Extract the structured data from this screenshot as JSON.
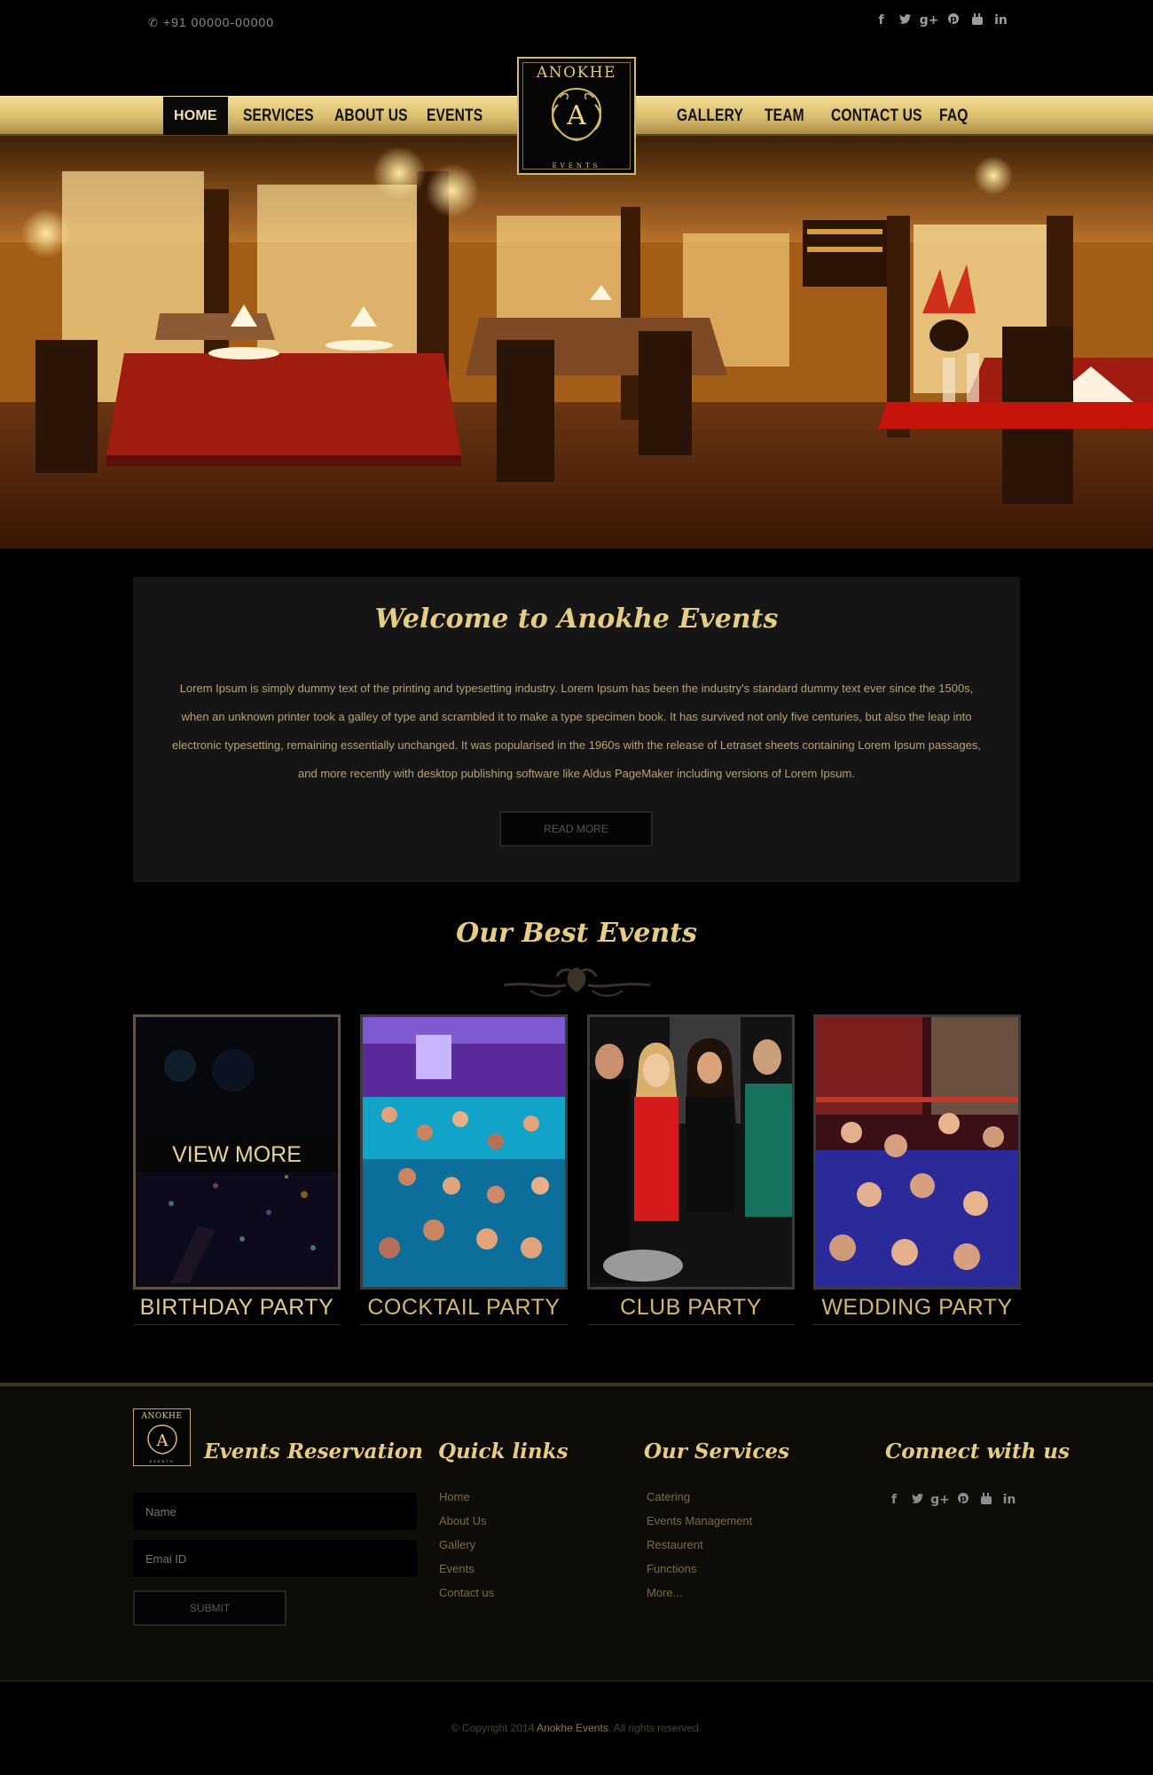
{
  "topbar": {
    "phone": "+91 00000-00000",
    "phone_icon": "phone-icon",
    "social": [
      "f",
      "🐦",
      "g+",
      "p",
      "▶",
      "in"
    ]
  },
  "nav": {
    "items": [
      "HOME",
      "SERVICES",
      "ABOUT US",
      "EVENTS",
      "GALLERY",
      "TEAM",
      "CONTACT US",
      "FAQ"
    ],
    "active": "HOME"
  },
  "logo": {
    "title": "ANOKHE",
    "letter": "A",
    "subtitle": "EVENTS"
  },
  "welcome": {
    "title": "Welcome to Anokhe Events",
    "body": "Lorem Ipsum is simply dummy text of the printing and typesetting industry. Lorem Ipsum has been the industry's standard dummy text ever since the 1500s, when an unknown printer took a galley of type and scrambled it to make a type specimen book. It has survived not only five centuries, but also the leap into electronic typesetting, remaining essentially unchanged. It was popularised in the 1960s with the release of Letraset sheets containing Lorem Ipsum passages, and more recently with desktop publishing software like Aldus PageMaker including versions of Lorem Ipsum.",
    "button": "READ MORE"
  },
  "events": {
    "title": "Our Best Events",
    "view_more": "VIEW MORE",
    "items": [
      {
        "label": "BIRTHDAY PARTY"
      },
      {
        "label": "COCKTAIL PARTY"
      },
      {
        "label": "CLUB PARTY"
      },
      {
        "label": "WEDDING PARTY"
      }
    ]
  },
  "footer": {
    "logo": {
      "title": "ANOKHE",
      "letter": "A",
      "subtitle": "EVENTS"
    },
    "reservation": {
      "title": "Events Reservation",
      "name_placeholder": "Name",
      "email_placeholder": "Emai ID",
      "submit": "SUBMIT"
    },
    "quick_links": {
      "title": "Quick links",
      "items": [
        "Home",
        "About Us",
        "Gallery",
        "Events",
        "Contact us"
      ]
    },
    "services": {
      "title": "Our Services",
      "items": [
        "Catering",
        "Events Management",
        "Restaurent",
        "Functions",
        "More..."
      ]
    },
    "connect": {
      "title": "Connect with us",
      "social": [
        "f",
        "🐦",
        "g+",
        "p",
        "▶",
        "in"
      ]
    }
  },
  "copyright": {
    "prefix": "© Copyright 2014",
    "brand": "Anokhe Events",
    "suffix": ". All rights reserved."
  },
  "colors": {
    "gold": "#e7cd83",
    "nav_gold": "#d9bd6e",
    "background": "#000000",
    "panel": "#151515"
  }
}
